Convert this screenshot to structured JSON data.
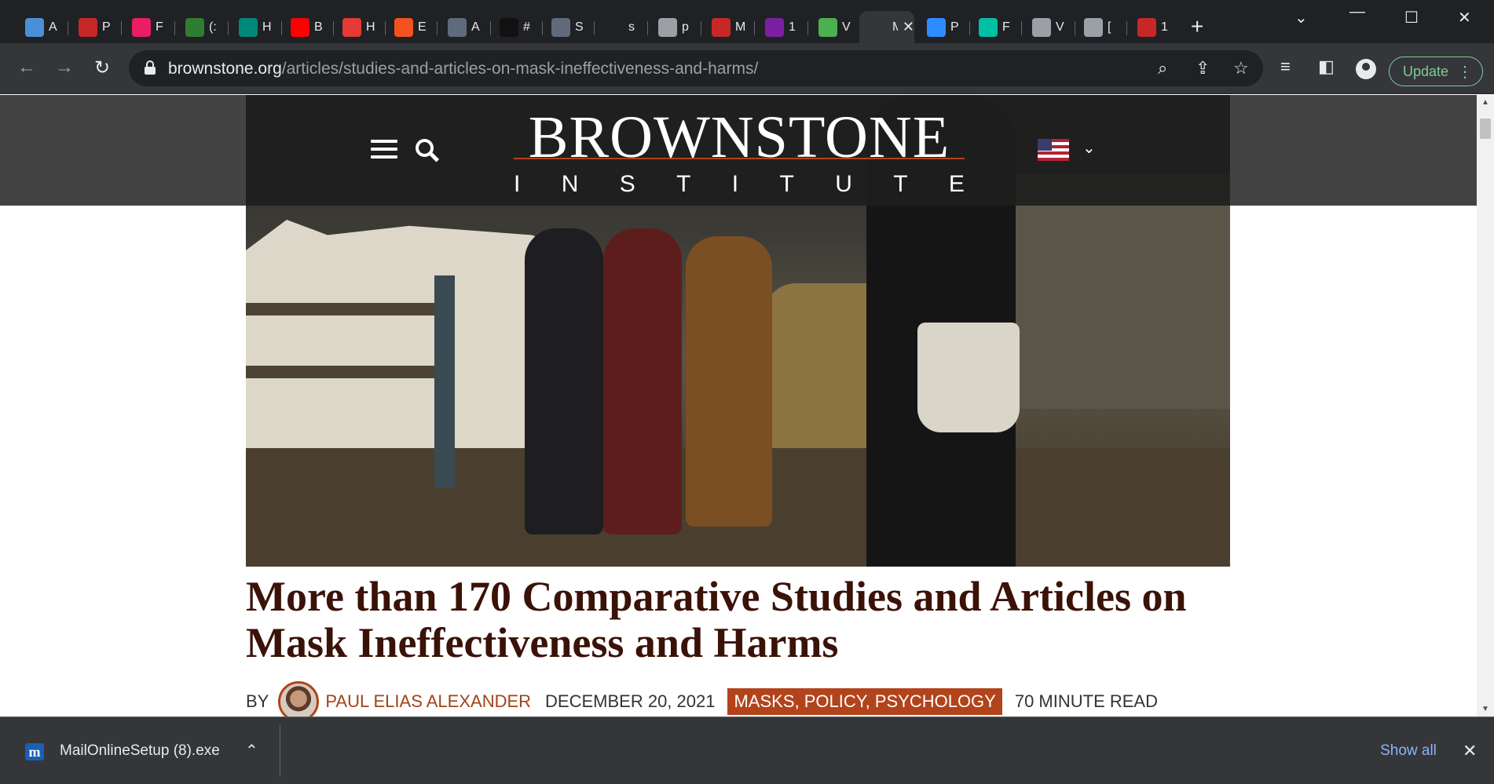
{
  "browser": {
    "tabs": [
      {
        "title": "A",
        "icon": "globe-icon",
        "color": "#4a90d9"
      },
      {
        "title": "P",
        "icon": "bi-icon",
        "color": "#c62828"
      },
      {
        "title": "F",
        "icon": "pinwheel-icon",
        "color": "#e91e63"
      },
      {
        "title": "(:",
        "icon": "g-icon",
        "color": "#2e7d32"
      },
      {
        "title": "H",
        "icon": "stat-icon",
        "color": "#00897b"
      },
      {
        "title": "B",
        "icon": "youtube-icon",
        "color": "#ff0000"
      },
      {
        "title": "H",
        "icon": "podcast-icon",
        "color": "#e53935"
      },
      {
        "title": "E",
        "icon": "rss-icon",
        "color": "#f4511e"
      },
      {
        "title": "A",
        "icon": "arrow-icon",
        "color": "#5f6b7a"
      },
      {
        "title": "#",
        "icon": "tiktok-icon",
        "color": "#111111"
      },
      {
        "title": "S",
        "icon": "arrow-icon",
        "color": "#5f6b7a"
      },
      {
        "title": "s",
        "icon": "blank-icon",
        "color": "#202124"
      },
      {
        "title": "p",
        "icon": "globe-icon",
        "color": "#9aa0a6"
      },
      {
        "title": "M",
        "icon": "bi-icon",
        "color": "#c62828"
      },
      {
        "title": "1",
        "icon": "mail-icon",
        "color": "#7b1fa2"
      },
      {
        "title": "V",
        "icon": "tree-icon",
        "color": "#4caf50"
      },
      {
        "title": "M",
        "icon": "brownstone-icon",
        "color": "#35363a",
        "active": true
      },
      {
        "title": "P",
        "icon": "zoom-icon",
        "color": "#2d8cff"
      },
      {
        "title": "F",
        "icon": "slash-icon",
        "color": "#00bfa5"
      },
      {
        "title": "V",
        "icon": "globe-icon",
        "color": "#9aa0a6"
      },
      {
        "title": "[",
        "icon": "stripes-icon",
        "color": "#9aa0a6"
      },
      {
        "title": "1",
        "icon": "bi-icon",
        "color": "#c62828"
      }
    ],
    "new_tab": "+",
    "url_host": "brownstone.org",
    "url_path": "/articles/studies-and-articles-on-mask-ineffectiveness-and-harms/",
    "update_label": "Update"
  },
  "site": {
    "logo_top": "BROWNSTONE",
    "logo_bottom": [
      "I",
      "N",
      "S",
      "T",
      "I",
      "T",
      "U",
      "T",
      "E"
    ]
  },
  "article": {
    "title": "More than 170 Comparative Studies and Articles on Mask Ineffectiveness and Harms",
    "by": "BY",
    "author": "PAUL ELIAS ALEXANDER",
    "date": "DECEMBER 20, 2021",
    "tags": "MASKS, POLICY, PSYCHOLOGY",
    "read_time": "70 MINUTE READ"
  },
  "downloads": {
    "file": "MailOnlineSetup (8).exe",
    "show_all": "Show all"
  },
  "colors": {
    "accent": "#b2431b",
    "title": "#3b1208",
    "bell": "#e54b4d"
  }
}
